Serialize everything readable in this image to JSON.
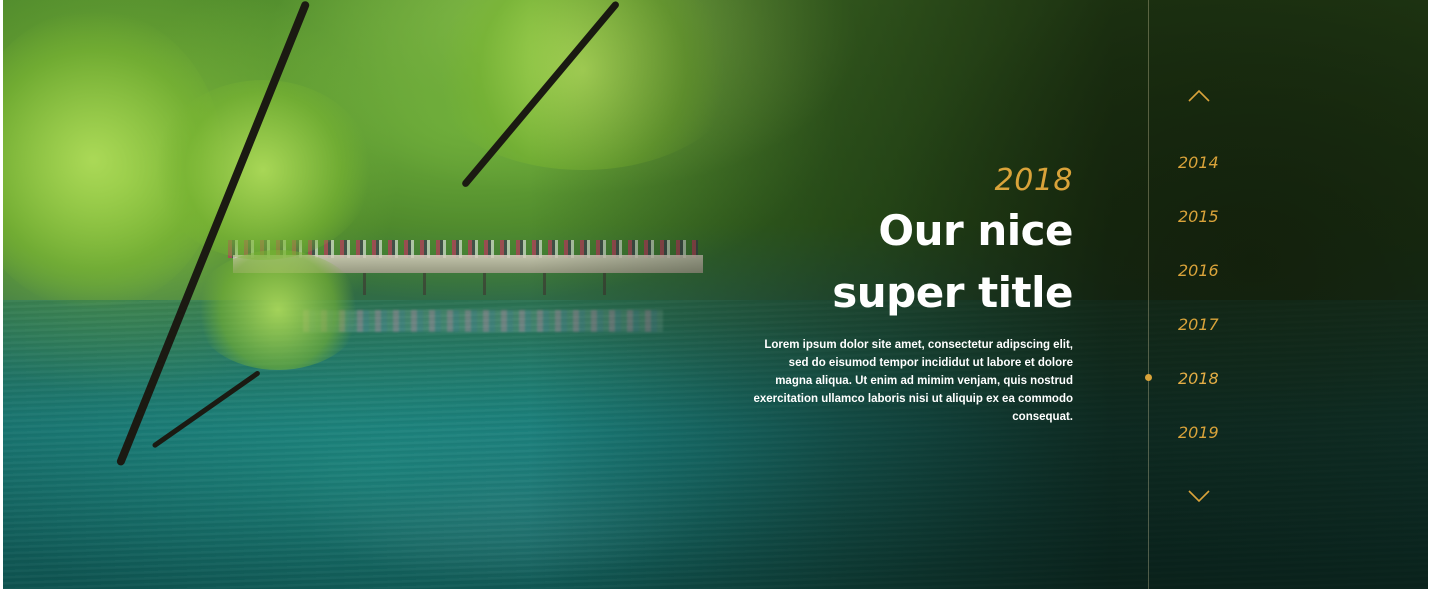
{
  "hero": {
    "year": "2018",
    "title_line1": "Our nice",
    "title_line2": "super title",
    "text": "Lorem ipsum dolor site amet, consectetur adipscing elit, sed do eisumod tempor incididut ut labore et dolore magna aliqua. Ut enim ad mimim venjam, quis nostrud exercitation ullamco laboris nisi ut aliquip ex ea commodo consequat."
  },
  "timeline": {
    "years": [
      "2014",
      "2015",
      "2016",
      "2017",
      "2018",
      "2019"
    ],
    "active": "2018",
    "up_icon": "chevron-up-icon",
    "down_icon": "chevron-down-icon"
  },
  "colors": {
    "accent": "#d9a33a",
    "text": "#ffffff"
  }
}
